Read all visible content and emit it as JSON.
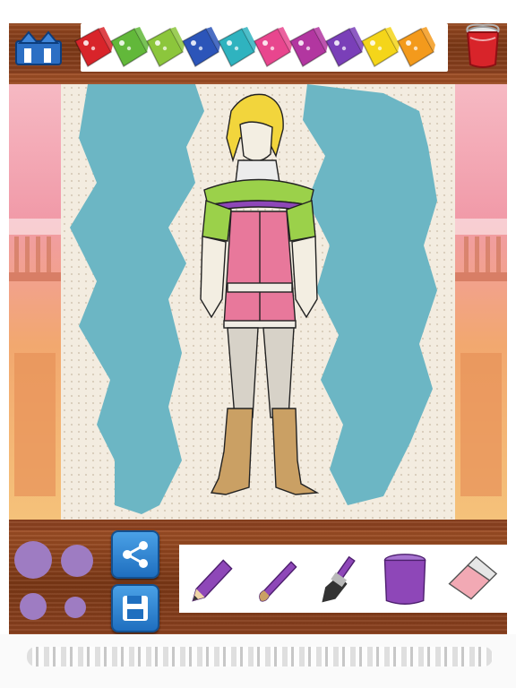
{
  "app": {
    "colors": {
      "wood": "#8b411c",
      "paper": "#f3ece0",
      "painted": "#6cb6c4",
      "selected_purple": "#8e47b8",
      "button_blue": "#2b7fd0"
    }
  },
  "top_bar": {
    "home_icon": "home-icon",
    "palette": [
      {
        "name": "red",
        "color": "#d8242a"
      },
      {
        "name": "green",
        "color": "#62b83a"
      },
      {
        "name": "lime",
        "color": "#8cc63c"
      },
      {
        "name": "blue",
        "color": "#2c55b9"
      },
      {
        "name": "teal",
        "color": "#2fb3bf"
      },
      {
        "name": "pink",
        "color": "#e8468e"
      },
      {
        "name": "magenta",
        "color": "#b236a0"
      },
      {
        "name": "purple",
        "color": "#7a3fb8"
      },
      {
        "name": "yellow",
        "color": "#f4d51a"
      },
      {
        "name": "orange",
        "color": "#f39a1c"
      }
    ],
    "bucket_icon": "paint-bucket-icon",
    "bucket_color": "#d8242a"
  },
  "canvas": {
    "figure": "coloring-page-character",
    "fill_color": "#6cb6c4"
  },
  "bottom_toolbar": {
    "brush_sizes": [
      "large",
      "medium",
      "small",
      "tiny"
    ],
    "brush_color": "#9e7cc2",
    "share_icon": "share-icon",
    "save_icon": "save-icon",
    "tools": [
      {
        "name": "pencil",
        "icon": "pencil-icon"
      },
      {
        "name": "brush",
        "icon": "brush-icon"
      },
      {
        "name": "wide-brush",
        "icon": "wide-brush-icon"
      },
      {
        "name": "fill-bucket",
        "icon": "fill-bucket-icon"
      },
      {
        "name": "eraser",
        "icon": "eraser-icon"
      }
    ],
    "active_color": "#8e47b8"
  }
}
